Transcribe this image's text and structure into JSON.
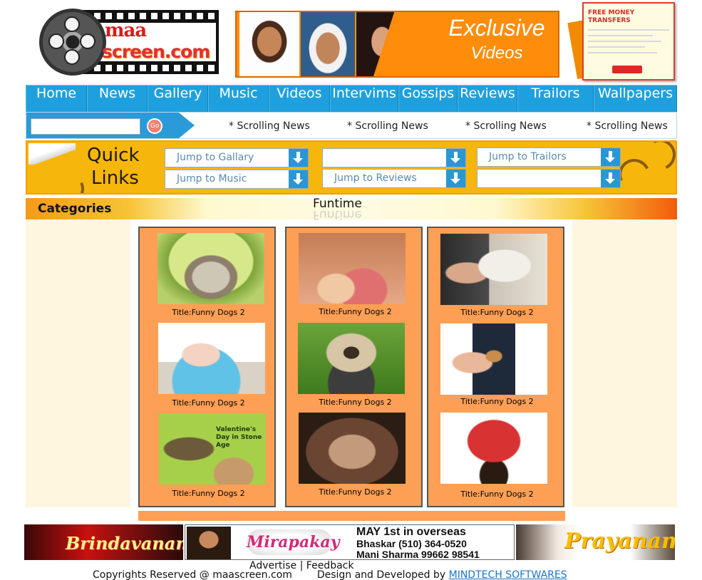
{
  "brand": {
    "line1": "maa",
    "line2": "screen.com"
  },
  "promo": {
    "title": "Exclusive",
    "subtitle": "Videos"
  },
  "side_ad": {
    "headline": "FREE MONEY TRANSFERS"
  },
  "nav": [
    {
      "label": "Home",
      "width": 86
    },
    {
      "label": "News",
      "width": 85
    },
    {
      "label": "Gallery",
      "width": 85
    },
    {
      "label": "Music",
      "width": 85
    },
    {
      "label": "Videos",
      "width": 86
    },
    {
      "label": "Intervims",
      "width": 96
    },
    {
      "label": "Gossips",
      "width": 83
    },
    {
      "label": "Reviews",
      "width": 84
    },
    {
      "label": "Trailors",
      "width": 107
    },
    {
      "label": "Wallpapers",
      "width": 117
    }
  ],
  "search": {
    "placeholder": "",
    "go_label": "Go"
  },
  "scrolling_news": [
    "* Scrolling News",
    "* Scrolling News",
    "* Scrolling News",
    "* Scrolling News"
  ],
  "quick_links": {
    "title_line1": "Quick",
    "title_line2": "Links",
    "selects": [
      {
        "value": "Jump to Gallary"
      },
      {
        "value": ""
      },
      {
        "value": "Jump to Trailors"
      },
      {
        "value": "Jump to Music"
      },
      {
        "value": "Jump to Reviews"
      },
      {
        "value": ""
      }
    ]
  },
  "categories_label": "Categories",
  "section_title": "Funtime",
  "gallery": {
    "columns": [
      {
        "items": [
          {
            "caption": "Title:Funny Dogs 2",
            "image": "cat-in-melon"
          },
          {
            "caption": "Title:Funny Dogs 2",
            "image": "baby-in-tub"
          },
          {
            "caption": "Title:Funny Dogs 2",
            "image": "stone-age-cartoon"
          }
        ]
      },
      {
        "items": [
          {
            "caption": "Title:Funny Dogs 2",
            "image": "kitten-in-top"
          },
          {
            "caption": "Title:Funny Dogs 2",
            "image": "pug-in-costume"
          },
          {
            "caption": "Title:Funny Dogs 2",
            "image": "monkey-face"
          }
        ]
      },
      {
        "items": [
          {
            "caption": "Title:Funny Dogs 2",
            "image": "magazine-kiss"
          },
          {
            "caption": "Title:Funny Dogs 2",
            "image": "legs-hand-nut"
          },
          {
            "caption": "Title:Funny Dogs 2",
            "image": "red-acrobats"
          }
        ]
      }
    ],
    "cartoon_text": "Valentine's Day in Stone Age"
  },
  "footer_banners": {
    "left_title": "Brindavanam",
    "middle": {
      "logo_text": "Mirapakay",
      "line1": "MAY 1st in overseas",
      "line2": "Bhaskar (510) 364-0520",
      "line3": "Mani Sharma 99662 98541"
    },
    "right_title": "Prayanam"
  },
  "footer": {
    "advertise": "Advertise",
    "separator": "|",
    "feedback": "Feedback",
    "copyright": "Copyrights Reserved @ maascreen.com",
    "designed_by": "Design and Developed by",
    "developer": "MINDTECH SOFTWARES"
  },
  "colors": {
    "nav_blue": "#1fa0de",
    "gallery_orange": "#fd9f55",
    "quick_links_yellow": "#f7b60b",
    "side_panel_cream": "#fff6e0",
    "link_blue": "#1a73c9"
  }
}
